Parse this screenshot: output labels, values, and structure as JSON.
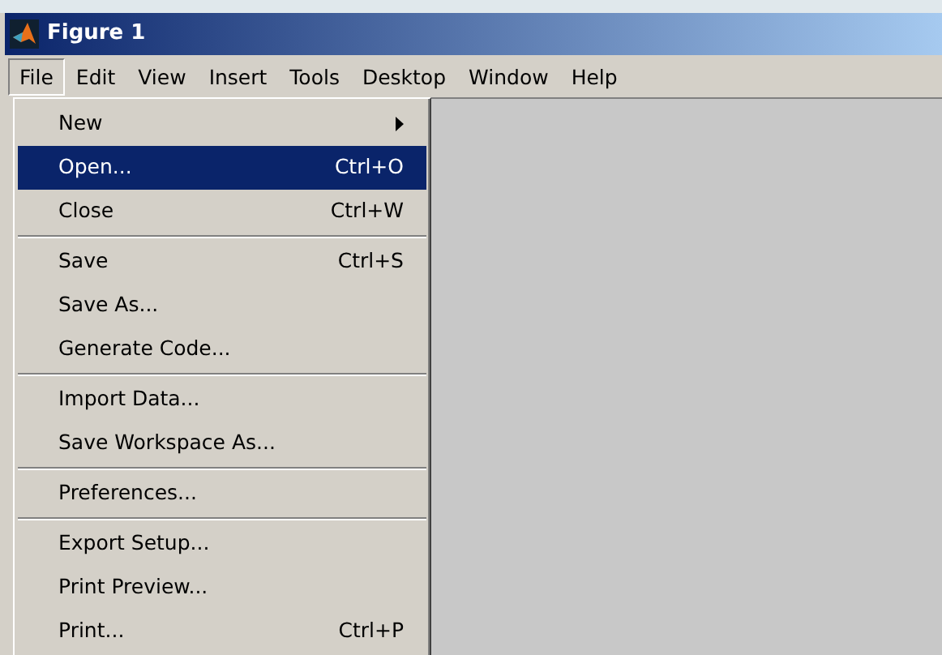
{
  "window": {
    "title": "Figure 1"
  },
  "menubar": [
    {
      "label": "File",
      "selected": true
    },
    {
      "label": "Edit",
      "selected": false
    },
    {
      "label": "View",
      "selected": false
    },
    {
      "label": "Insert",
      "selected": false
    },
    {
      "label": "Tools",
      "selected": false
    },
    {
      "label": "Desktop",
      "selected": false
    },
    {
      "label": "Window",
      "selected": false
    },
    {
      "label": "Help",
      "selected": false
    }
  ],
  "file_menu": [
    [
      {
        "label": "New",
        "submenu": true,
        "selected": false
      },
      {
        "label": "Open...",
        "shortcut": "Ctrl+O",
        "selected": true
      },
      {
        "label": "Close",
        "shortcut": "Ctrl+W",
        "selected": false
      }
    ],
    [
      {
        "label": "Save",
        "shortcut": "Ctrl+S",
        "selected": false
      },
      {
        "label": "Save As...",
        "selected": false
      },
      {
        "label": "Generate Code...",
        "selected": false
      }
    ],
    [
      {
        "label": "Import Data...",
        "selected": false
      },
      {
        "label": "Save Workspace As...",
        "selected": false
      }
    ],
    [
      {
        "label": "Preferences...",
        "selected": false
      }
    ],
    [
      {
        "label": "Export Setup...",
        "selected": false
      },
      {
        "label": "Print Preview...",
        "selected": false
      },
      {
        "label": "Print...",
        "shortcut": "Ctrl+P",
        "selected": false
      }
    ]
  ]
}
